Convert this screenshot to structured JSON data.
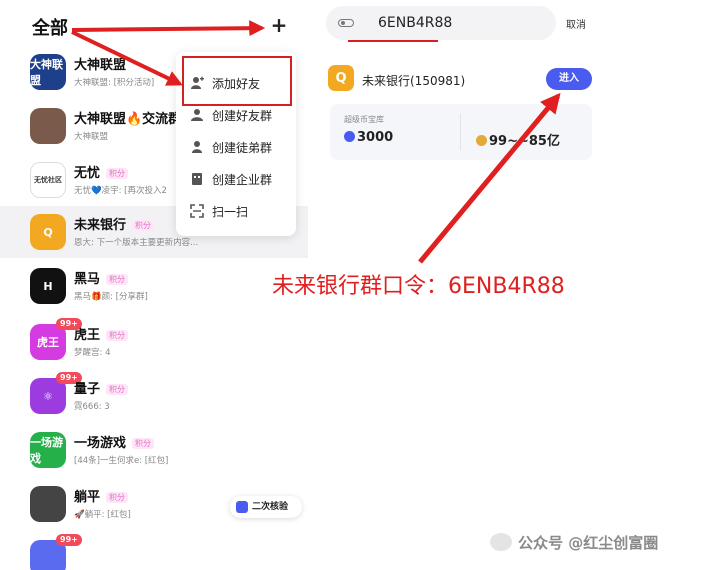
{
  "colors": {
    "accent": "#4a5bf0",
    "annotation": "#e02020",
    "badge": "#f34a5b",
    "tag": "#e66fc8"
  },
  "header": {
    "title": "全部",
    "plus_icon": "plus-icon",
    "plus_label": "+"
  },
  "chats": [
    {
      "name": "大神联盟",
      "preview": "大神联盟: [积分活动]",
      "tag": "",
      "badge": "",
      "avatar_text": "大神联盟",
      "avatar_color": "#1e3f8a"
    },
    {
      "name": "大神联盟🔥交流群",
      "preview": "大神联盟",
      "tag": "",
      "badge": "",
      "avatar_text": "",
      "avatar_color": "#7a5a4a"
    },
    {
      "name": "无忧",
      "preview": "无忧💙凌宇: [再次投入2",
      "tag": "积分",
      "badge": "",
      "avatar_text": "无忧社区",
      "avatar_color": "#ffffff"
    },
    {
      "name": "未来银行",
      "preview": "恩大: 下一个版本主要更新内容...",
      "tag": "积分",
      "badge": "",
      "avatar_text": "Q",
      "avatar_color": "#f3a822"
    },
    {
      "name": "黑马",
      "preview": "黑马🎁颜: [分享群]",
      "tag": "积分",
      "badge": "",
      "avatar_text": "H",
      "avatar_color": "#111111"
    },
    {
      "name": "虎王",
      "preview": "梦醒宫: 4",
      "tag": "积分",
      "badge": "99+",
      "avatar_text": "虎王",
      "avatar_color": "#d43be0"
    },
    {
      "name": "量子",
      "preview": "霓666: 3",
      "tag": "积分",
      "badge": "99+",
      "avatar_text": "⚛",
      "avatar_color": "#9b3be0"
    },
    {
      "name": "一场游戏",
      "preview": "[44条]一生何求e: [红包]",
      "tag": "积分",
      "badge": "",
      "avatar_text": "一场游戏",
      "avatar_color": "#25b04a"
    },
    {
      "name": "躺平",
      "preview": "🚀躺平: [红包]",
      "tag": "积分",
      "badge": "",
      "avatar_text": "",
      "avatar_color": "#444444"
    }
  ],
  "partial_chat_badge": "99+",
  "menu": {
    "items": [
      {
        "label": "添加好友",
        "icon": "add-friend-icon"
      },
      {
        "label": "创建好友群",
        "icon": "friends-group-icon"
      },
      {
        "label": "创建徒弟群",
        "icon": "apprentice-group-icon"
      },
      {
        "label": "创建企业群",
        "icon": "enterprise-group-icon"
      },
      {
        "label": "扫一扫",
        "icon": "scan-icon"
      }
    ]
  },
  "search": {
    "value": "6ENB4R88",
    "cancel": "取消",
    "icon": "search-icon"
  },
  "result": {
    "name": "未来银行(150981)",
    "enter_label": "进入",
    "avatar_text": "Q"
  },
  "vault": {
    "title": "超级币宝库",
    "value1": "3000",
    "value2": "99~~85亿"
  },
  "caption": "未来银行群口令：6ENB4R88",
  "verify": {
    "label": "二次核验"
  },
  "watermark": {
    "text": "公众号 @红尘创富圈"
  }
}
